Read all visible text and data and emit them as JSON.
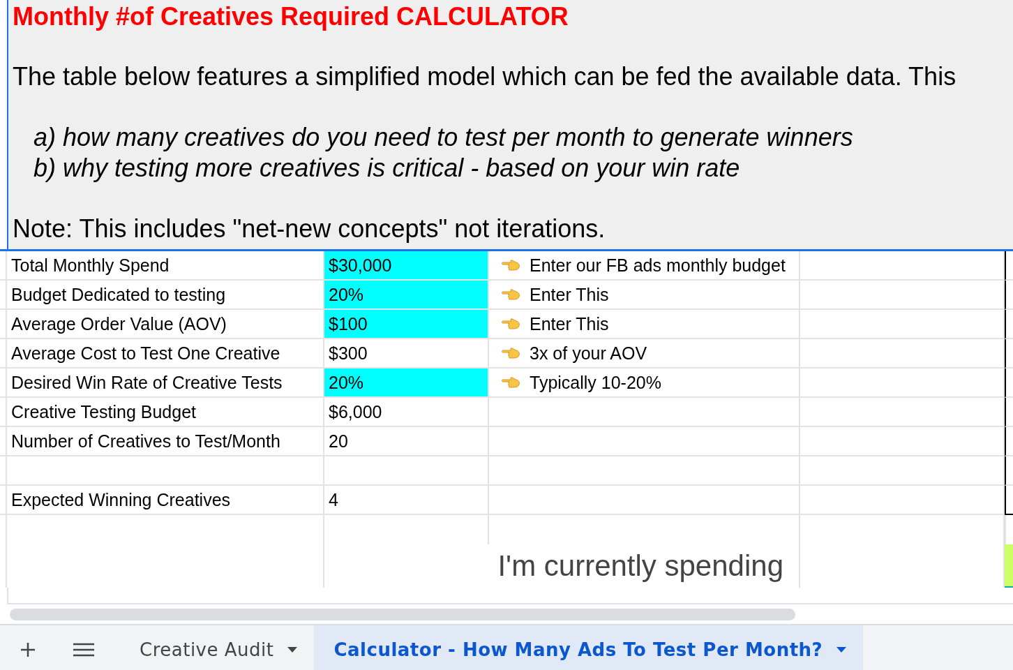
{
  "header": {
    "title": "Monthly #of Creatives Required CALCULATOR",
    "intro": "The table below features a simplified model which can be fed the available data. This",
    "points": [
      "a) how many creatives do you need to test per month to generate winners",
      "b) why testing more creatives is critical - based on your win rate"
    ],
    "note": "Note: This includes \"net-new concepts\" not iterations."
  },
  "rows": [
    {
      "label": "Total Monthly Spend",
      "value": "$30,000",
      "highlighted": true,
      "hint": "Enter our FB ads monthly budget"
    },
    {
      "label": "Budget Dedicated to testing",
      "value": "20%",
      "highlighted": true,
      "hint": "Enter This"
    },
    {
      "label": "Average Order Value (AOV)",
      "value": "$100",
      "highlighted": true,
      "hint": "Enter This"
    },
    {
      "label": "Average Cost to Test One Creative",
      "value": "$300",
      "highlighted": false,
      "hint": "3x of your AOV"
    },
    {
      "label": "Desired Win Rate of Creative Tests",
      "value": "20%",
      "highlighted": true,
      "hint": "Typically 10-20%"
    },
    {
      "label": "Creative Testing Budget",
      "value": "$6,000",
      "highlighted": false
    },
    {
      "label": "Number of Creatives to Test/Month",
      "value": "20",
      "highlighted": false
    },
    {},
    {
      "label": "Expected Winning Creatives",
      "value": "4",
      "highlighted": false
    }
  ],
  "spending_text": "I'm currently spending",
  "sheet_tabs": [
    {
      "label": "Creative Audit",
      "selected": false
    },
    {
      "label": "Calculator - How Many Ads To Test Per Month?",
      "selected": true
    }
  ]
}
